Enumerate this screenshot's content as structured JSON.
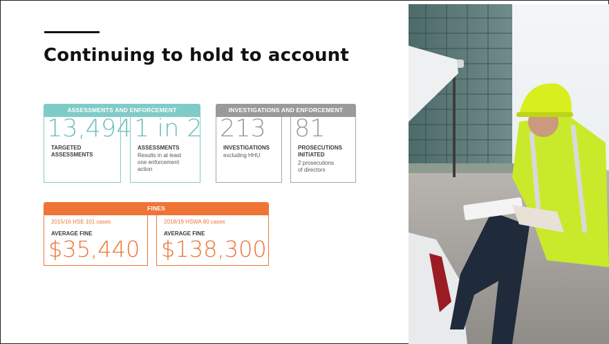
{
  "slide": {
    "title": "Continuing to hold to account"
  },
  "assessments_group": {
    "header": "ASSESSMENTS AND ENFORCEMENT",
    "cards": [
      {
        "value": "13,494",
        "label_line1": "TARGETED",
        "label_line2": "ASSESSMENTS"
      },
      {
        "value": "1 in 2",
        "label_line1": "ASSESSMENTS",
        "desc_line1": "Results in at least",
        "desc_line2": "one enforcement",
        "desc_line3": "action"
      }
    ]
  },
  "investigations_group": {
    "header": "INVESTIGATIONS AND ENFORCEMENT",
    "cards": [
      {
        "value": "213",
        "label_line1": "INVESTIGATIONS",
        "desc_line1": "excluding HHU"
      },
      {
        "value": "81",
        "label_line1": "PROSECUTIONS",
        "label_line2": "INITIATED",
        "desc_line1": "2 prosecutions",
        "desc_line2": "of directors"
      }
    ]
  },
  "fines_group": {
    "header": "FINES",
    "cards": [
      {
        "caption": "2015/16 HSE 101 cases",
        "label": "AVERAGE FINE",
        "value": "$35,440"
      },
      {
        "caption": "2018/19 HSWA 80 cases",
        "label": "AVERAGE FINE",
        "value": "$138,300"
      }
    ]
  },
  "colors": {
    "teal": "#7fcbc8",
    "grey": "#9a9a9a",
    "orange": "#ef7436",
    "hi_vis_vest": "#c9ea2a"
  },
  "photo": {
    "icon": "inspector-photo"
  }
}
